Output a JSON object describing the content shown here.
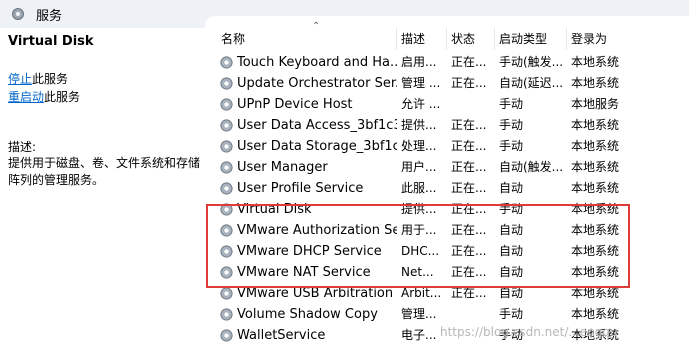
{
  "window": {
    "title": "服务"
  },
  "left_panel": {
    "service_name": "Virtual Disk",
    "stop_link": "停止",
    "stop_suffix": "此服务",
    "restart_link": "重启动",
    "restart_suffix": "此服务",
    "desc_label": "描述:",
    "desc_text": "提供用于磁盘、卷、文件系统和存储阵列的管理服务。"
  },
  "columns": {
    "name": "名称",
    "desc": "描述",
    "status": "状态",
    "startup": "启动类型",
    "logon": "登录为"
  },
  "services": [
    {
      "name": "Touch Keyboard and Ha...",
      "desc": "启用...",
      "status": "正在...",
      "startup": "手动(触发...",
      "logon": "本地系统"
    },
    {
      "name": "Update Orchestrator Ser...",
      "desc": "管理 ...",
      "status": "正在...",
      "startup": "自动(延迟...",
      "logon": "本地系统"
    },
    {
      "name": "UPnP Device Host",
      "desc": "允许 ...",
      "status": "",
      "startup": "手动",
      "logon": "本地服务"
    },
    {
      "name": "User Data Access_3bf1c3...",
      "desc": "提供...",
      "status": "正在...",
      "startup": "手动",
      "logon": "本地系统"
    },
    {
      "name": "User Data Storage_3bf1c...",
      "desc": "处理...",
      "status": "正在...",
      "startup": "手动",
      "logon": "本地系统"
    },
    {
      "name": "User Manager",
      "desc": "用户...",
      "status": "正在...",
      "startup": "自动(触发...",
      "logon": "本地系统"
    },
    {
      "name": "User Profile Service",
      "desc": "此服...",
      "status": "正在...",
      "startup": "自动",
      "logon": "本地系统"
    },
    {
      "name": "Virtual Disk",
      "desc": "提供...",
      "status": "正在...",
      "startup": "手动",
      "logon": "本地系统"
    },
    {
      "name": "VMware Authorization Se...",
      "desc": "用于...",
      "status": "正在...",
      "startup": "自动",
      "logon": "本地系统"
    },
    {
      "name": "VMware DHCP Service",
      "desc": "DHC...",
      "status": "正在...",
      "startup": "自动",
      "logon": "本地系统"
    },
    {
      "name": "VMware NAT Service",
      "desc": "Net...",
      "status": "正在...",
      "startup": "自动",
      "logon": "本地系统"
    },
    {
      "name": "VMware USB Arbitration ...",
      "desc": "Arbit...",
      "status": "正在...",
      "startup": "自动",
      "logon": "本地系统"
    },
    {
      "name": "Volume Shadow Copy",
      "desc": "管理...",
      "status": "",
      "startup": "手动",
      "logon": "本地系统"
    },
    {
      "name": "WalletService",
      "desc": "电子...",
      "status": "",
      "startup": "手动",
      "logon": "本地系统"
    }
  ],
  "watermark": "https://blog.csdn.net/...engqu",
  "icons": {
    "window": "gear-icon",
    "service": "gear-icon"
  },
  "colors": {
    "highlight": "#e03b3b",
    "link": "#0066cc"
  }
}
